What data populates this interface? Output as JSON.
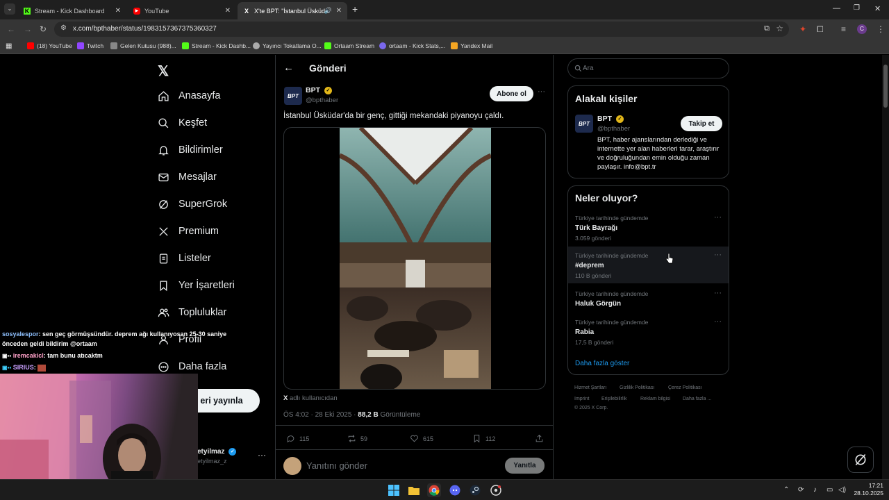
{
  "tabs": [
    {
      "title": "Stream - Kick Dashboard",
      "icon": "kick-icon",
      "active": false
    },
    {
      "title": "YouTube",
      "icon": "youtube-icon",
      "active": false
    },
    {
      "title": "X'te BPT: \"İstanbul Üsküda",
      "icon": "x-icon",
      "active": true
    }
  ],
  "address_bar": {
    "url": "x.com/bpthaber/status/1983157367375360327"
  },
  "bookmarks": [
    {
      "label": "(18) YouTube",
      "color": "#ff0000"
    },
    {
      "label": "Twitch",
      "color": "#9146ff"
    },
    {
      "label": "Gelen Kutusu (988)...",
      "color": "#888888"
    },
    {
      "label": "Stream - Kick Dashb...",
      "color": "#53fc18"
    },
    {
      "label": "Yayıncı Tokatlama O...",
      "color": "#aaaaaa"
    },
    {
      "label": "Ortaam Stream",
      "color": "#53fc18"
    },
    {
      "label": "ortaam - Kick Stats,...",
      "color": "#7b68ee"
    },
    {
      "label": "Yandex Mail",
      "color": "#f5a623"
    }
  ],
  "sidebar": {
    "items": [
      {
        "label": "Anasayfa",
        "icon": "home-icon"
      },
      {
        "label": "Keşfet",
        "icon": "search-icon"
      },
      {
        "label": "Bildirimler",
        "icon": "bell-icon"
      },
      {
        "label": "Mesajlar",
        "icon": "mail-icon"
      },
      {
        "label": "SuperGrok",
        "icon": "grok-icon"
      },
      {
        "label": "Premium",
        "icon": "x-icon"
      },
      {
        "label": "Listeler",
        "icon": "list-icon"
      },
      {
        "label": "Yer İşaretleri",
        "icon": "bookmark-icon"
      },
      {
        "label": "Topluluklar",
        "icon": "people-icon"
      },
      {
        "label": "Profil",
        "icon": "person-icon"
      },
      {
        "label": "Daha fazla",
        "icon": "more-circle-icon"
      }
    ],
    "post_button": "eri yayınla",
    "account_name": "etyilmaz",
    "account_handle": "etyilmaz_z"
  },
  "post": {
    "header_title": "Gönderi",
    "author_name": "BPT",
    "author_handle": "@bpthaber",
    "avatar_text": "BPT",
    "follow_label": "Abone ol",
    "text": "İstanbul Üsküdar'da bir genç, gittiği mekandaki piyanoyu çaldı.",
    "source_text": "adlı kullanıcıdan",
    "timestamp": "ÖS 4:02 · 28 Eki 2025 · ",
    "views_count": "88,2 B",
    "views_label": "Görüntüleme",
    "stats": {
      "replies": "115",
      "reposts": "59",
      "likes": "615",
      "bookmarks": "112"
    },
    "reply_placeholder": "Yanıtını gönder",
    "reply_button": "Yanıtla"
  },
  "right": {
    "search_placeholder": "Ara",
    "relevant_title": "Alakalı kişiler",
    "relevant_person": {
      "name": "BPT",
      "handle": "@bpthaber",
      "follow_label": "Takip et",
      "bio": "BPT, haber ajanslarından derlediği ve internette yer alan haberleri tarar, araştırır ve doğruluğundan emin olduğu zaman paylaşır. info@bpt.tr"
    },
    "trends_title": "Neler oluyor?",
    "trends": [
      {
        "context": "Türkiye tarihinde gündemde",
        "name": "Türk Bayrağı",
        "count": "3.059 gönderi"
      },
      {
        "context": "Türkiye tarihinde gündemde",
        "name": "#deprem",
        "count": "110 B gönderi"
      },
      {
        "context": "Türkiye tarihinde gündemde",
        "name": "Haluk Görgün",
        "count": ""
      },
      {
        "context": "Türkiye tarihinde gündemde",
        "name": "Rabia",
        "count": "17,5 B gönderi"
      }
    ],
    "show_more": "Daha fazla göster",
    "footer": [
      "Hizmet Şartları",
      "Gizlilik Politikası",
      "Çerez Politikası",
      "Imprint",
      "Erişilebilirlik",
      "Reklam bilgisi",
      "Daha fazla ...",
      "© 2025 X Corp."
    ]
  },
  "chat": [
    {
      "user": "sosyalespor",
      "text": ": sen geç görmüşsündür. deprem ağı kullanıyosan 25-30 saniye"
    },
    {
      "user": "",
      "text": "önceden geldi bildirim @ortaam"
    },
    {
      "user": "iremcakicl",
      "text": ": tam bunu atıcaktm"
    },
    {
      "user": "SIRIUS",
      "text": ":"
    }
  ],
  "taskbar": {
    "time": "17:21",
    "date": "28.10.2025"
  },
  "colors": {
    "accent_blue": "#1d9bf0",
    "verified_gold": "#e2b719",
    "kick_green": "#53fc18"
  }
}
